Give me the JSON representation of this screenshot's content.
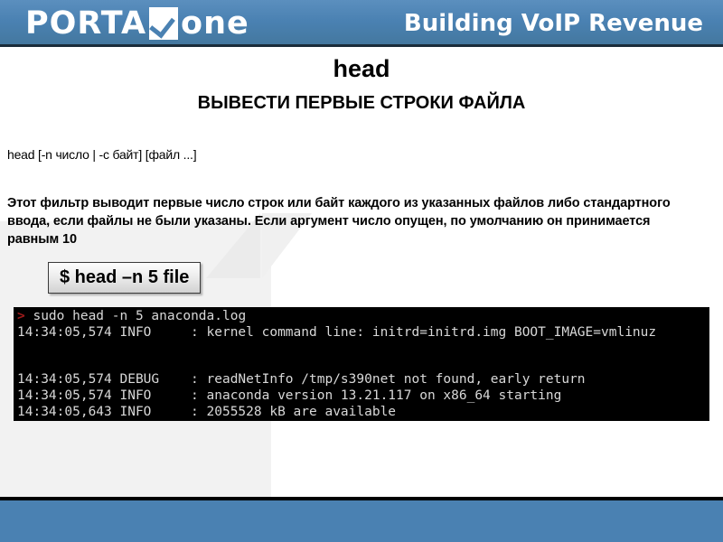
{
  "header": {
    "logo_word_1": "PORTA",
    "logo_mark_icon": "check-square-icon",
    "logo_word_2": "one",
    "tagline": "Building VoIP Revenue",
    "bar_color": "#4a81b2",
    "rule_color": "#1b2c3a"
  },
  "slide": {
    "title": "head",
    "subtitle": "ВЫВЕСТИ ПЕРВЫЕ СТРОКИ ФАЙЛА",
    "syntax": "head [-n число | -c байт] [файл ...]",
    "description": "Этот фильтр выводит первые число строк или байт каждого из указанных файлов либо стандартного ввода, если файлы не были указаны.  Если аргумент число опущен, по умолчанию он принимается равным 10",
    "command_chip": "$ head –n 5 file"
  },
  "terminal": {
    "prompt_symbol": ">",
    "command": "sudo head -n 5 anaconda.log",
    "lines": [
      "14:34:05,574 INFO     : kernel command line: initrd=initrd.img BOOT_IMAGE=vmlinuz",
      "",
      "",
      "14:34:05,574 DEBUG    : readNetInfo /tmp/s390net not found, early return",
      "14:34:05,574 INFO     : anaconda version 13.21.117 on x86_64 starting",
      "14:34:05,643 INFO     : 2055528 kB are available"
    ],
    "background_color": "#000000",
    "text_color": "#d8d8d8",
    "prompt_color": "#9e1b1b"
  },
  "footer": {
    "bar_color": "#4a81b2",
    "rule_color": "#000000"
  }
}
